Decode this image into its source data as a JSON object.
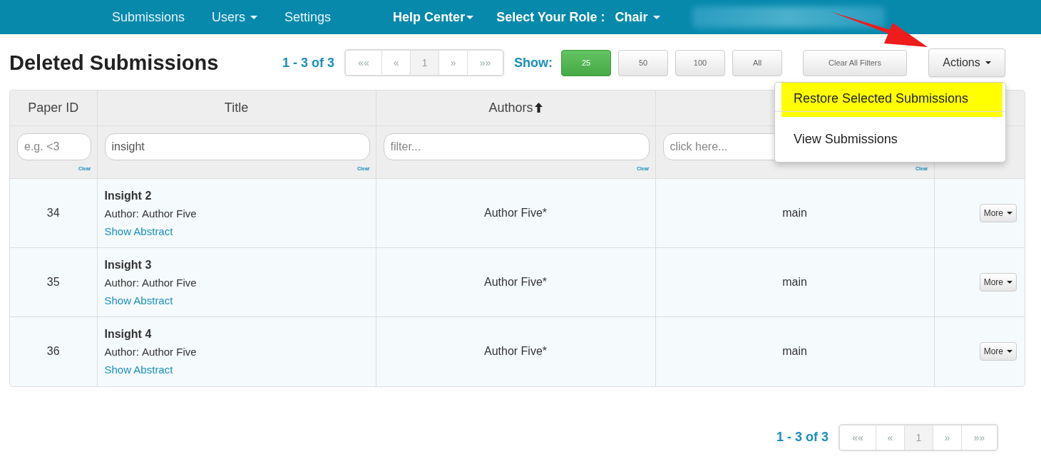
{
  "nav": {
    "links": [
      {
        "label": "Submissions",
        "caret": false
      },
      {
        "label": "Users",
        "caret": true
      },
      {
        "label": "Settings",
        "caret": false
      }
    ],
    "help": {
      "label": "Help Center",
      "caret": true
    },
    "role_label": "Select Your Role :",
    "role": {
      "label": "Chair",
      "caret": true
    }
  },
  "page_title": "Deleted Submissions",
  "pager_top": {
    "range": "1 - 3 of 3",
    "buttons": [
      {
        "label": "««",
        "selected": false
      },
      {
        "label": "«",
        "selected": false
      },
      {
        "label": "1",
        "selected": true
      },
      {
        "label": "»",
        "selected": false
      },
      {
        "label": "»»",
        "selected": false
      }
    ]
  },
  "show": {
    "label": "Show:",
    "options": [
      {
        "label": "25",
        "selected": true
      },
      {
        "label": "50",
        "selected": false
      },
      {
        "label": "100",
        "selected": false
      },
      {
        "label": "All",
        "selected": false
      }
    ]
  },
  "clear_filters": "Clear All Filters",
  "actions": {
    "label": "Actions",
    "menu": [
      {
        "label": "Restore Selected Submissions",
        "highlighted": true
      },
      {
        "label": "View Submissions",
        "highlighted": false
      }
    ]
  },
  "table": {
    "columns": [
      {
        "label": "Paper ID",
        "sorted": false
      },
      {
        "label": "Title",
        "sorted": false
      },
      {
        "label": "Authors",
        "sorted": true
      }
    ],
    "filters": [
      {
        "placeholder": "e.g. <3",
        "clear": "Clear"
      },
      {
        "value": "insight",
        "clear": "Clear"
      },
      {
        "placeholder": "filter...",
        "clear": "Clear"
      },
      {
        "placeholder": "click here...",
        "clear": "Clear"
      }
    ],
    "rows": [
      {
        "paper_id": "34",
        "title": "Insight 2",
        "author_label": "Author:",
        "author": "Author Five",
        "abstract_link": "Show Abstract",
        "authors": "Author Five*",
        "column_4": "main",
        "more": "More"
      },
      {
        "paper_id": "35",
        "title": "Insight 3",
        "author_label": "Author:",
        "author": "Author Five",
        "abstract_link": "Show Abstract",
        "authors": "Author Five*",
        "column_4": "main",
        "more": "More"
      },
      {
        "paper_id": "36",
        "title": "Insight 4",
        "author_label": "Author:",
        "author": "Author Five",
        "abstract_link": "Show Abstract",
        "authors": "Author Five*",
        "column_4": "main",
        "more": "More"
      }
    ]
  },
  "pager_bottom": {
    "range": "1 - 3 of 3",
    "buttons": [
      {
        "label": "««",
        "selected": false
      },
      {
        "label": "«",
        "selected": false
      },
      {
        "label": "1",
        "selected": true
      },
      {
        "label": "»",
        "selected": false
      },
      {
        "label": "»»",
        "selected": false
      }
    ]
  }
}
